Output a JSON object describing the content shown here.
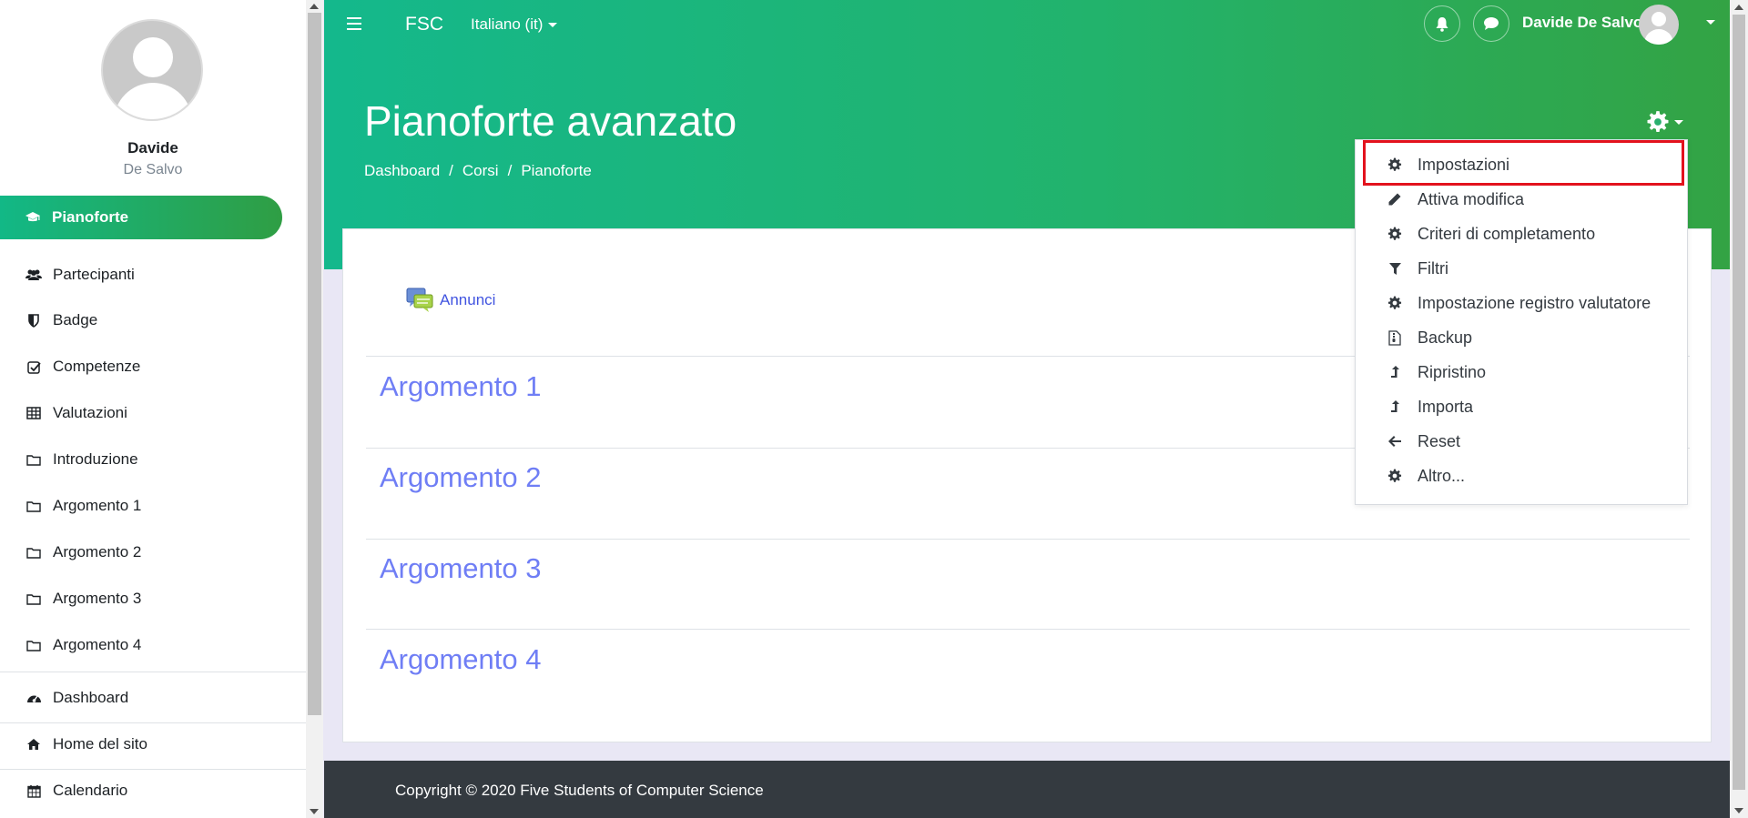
{
  "sidebar": {
    "user_first": "Davide",
    "user_last": "De Salvo",
    "active_item": "Pianoforte",
    "items": [
      {
        "label": "Partecipanti",
        "icon": "users-icon"
      },
      {
        "label": "Badge",
        "icon": "shield-icon"
      },
      {
        "label": "Competenze",
        "icon": "checkbox-icon"
      },
      {
        "label": "Valutazioni",
        "icon": "table-icon"
      },
      {
        "label": "Introduzione",
        "icon": "folder-icon"
      },
      {
        "label": "Argomento 1",
        "icon": "folder-icon"
      },
      {
        "label": "Argomento 2",
        "icon": "folder-icon"
      },
      {
        "label": "Argomento 3",
        "icon": "folder-icon"
      },
      {
        "label": "Argomento 4",
        "icon": "folder-icon"
      }
    ],
    "bottom_items": [
      {
        "label": "Dashboard",
        "icon": "dashboard-icon"
      },
      {
        "label": "Home del sito",
        "icon": "home-icon"
      },
      {
        "label": "Calendario",
        "icon": "calendar-icon"
      }
    ]
  },
  "header": {
    "brand": "FSC",
    "language": "Italiano (it)",
    "username": "Davide De Salvo",
    "page_title": "Pianoforte avanzato",
    "breadcrumb": [
      "Dashboard",
      "Corsi",
      "Pianoforte"
    ],
    "breadcrumb_separator": "/"
  },
  "main": {
    "announcements": "Annunci",
    "topics": [
      "Argomento 1",
      "Argomento 2",
      "Argomento 3",
      "Argomento 4"
    ]
  },
  "settings_menu": {
    "highlighted_item": "Impostazioni",
    "items": [
      {
        "label": "Impostazioni",
        "icon": "gear-icon"
      },
      {
        "label": "Attiva modifica",
        "icon": "pencil-icon"
      },
      {
        "label": "Criteri di completamento",
        "icon": "gear-icon"
      },
      {
        "label": "Filtri",
        "icon": "filter-icon"
      },
      {
        "label": "Impostazione registro valutatore",
        "icon": "gear-icon"
      },
      {
        "label": "Backup",
        "icon": "file-archive-icon"
      },
      {
        "label": "Ripristino",
        "icon": "level-up-icon"
      },
      {
        "label": "Importa",
        "icon": "level-up-icon"
      },
      {
        "label": "Reset",
        "icon": "arrow-left-icon"
      },
      {
        "label": "Altro...",
        "icon": "gear-icon"
      }
    ]
  },
  "footer": {
    "copyright": "Copyright © 2020 Five Students of Computer Science"
  },
  "colors": {
    "header_gradient_start": "#14b88c",
    "header_gradient_end": "#33a344",
    "link_blue": "#4154e0",
    "topic_blue": "#6f7ef5",
    "highlight_red": "#e3121d",
    "footer_bg": "#343a40"
  }
}
